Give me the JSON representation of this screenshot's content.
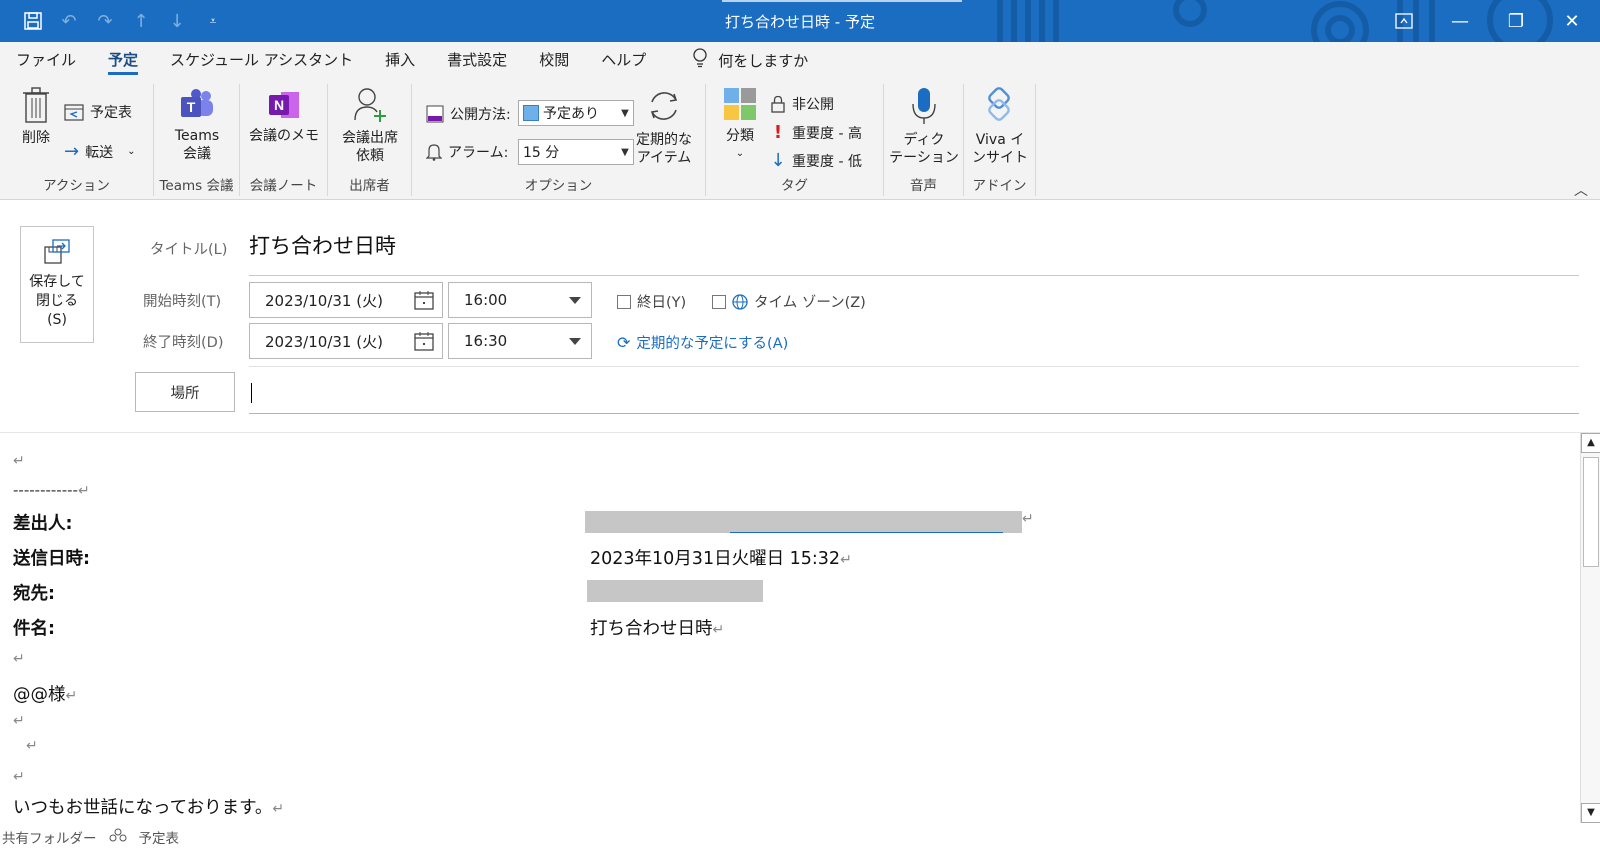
{
  "titlebar": {
    "title": "打ち合わせ日時 - 予定",
    "qat": [
      "save-icon",
      "undo-icon",
      "redo-icon",
      "up-icon",
      "down-icon",
      "customize-icon"
    ],
    "controls": [
      "ribbon-display-icon",
      "minimize-icon",
      "restore-icon",
      "close-icon"
    ]
  },
  "tabs": [
    "ファイル",
    "予定",
    "スケジュール アシスタント",
    "挿入",
    "書式設定",
    "校閲",
    "ヘルプ"
  ],
  "tellme": "何をしますか",
  "ribbon": {
    "actions": {
      "delete": "削除",
      "calendar": "予定表",
      "forward": "転送",
      "label": "アクション"
    },
    "teams": {
      "button": [
        "Teams",
        "会議"
      ],
      "label": "Teams 会議"
    },
    "notes": {
      "button": "会議のメモ",
      "label": "会議ノート"
    },
    "attendees": {
      "button": [
        "会議出席",
        "依頼"
      ],
      "label": "出席者"
    },
    "options": {
      "showas_label": "公開方法:",
      "showas_value": "予定あり",
      "reminder_label": "アラーム:",
      "reminder_value": "15 分",
      "recurrence": [
        "定期的な",
        "アイテム"
      ],
      "label": "オプション"
    },
    "tags": {
      "categorize": "分類",
      "private": "非公開",
      "high": "重要度 - 高",
      "low": "重要度 - 低",
      "label": "タグ"
    },
    "voice": {
      "button": [
        "ディク",
        "テーション"
      ],
      "label": "音声"
    },
    "addin": {
      "button": [
        "Viva イ",
        "ンサイト"
      ],
      "label": "アドイン"
    }
  },
  "form": {
    "save": [
      "保存して",
      "閉じる",
      "(S)"
    ],
    "title_label": "タイトル(L)",
    "title_value": "打ち合わせ日時",
    "start_label": "開始時刻(T)",
    "start_date": "2023/10/31 (火)",
    "start_time": "16:00",
    "end_label": "終了時刻(D)",
    "end_date": "2023/10/31 (火)",
    "end_time": "16:30",
    "allday": "終日(Y)",
    "timezone": "タイム ゾーン(Z)",
    "recurring": "定期的な予定にする(A)",
    "location_button": "場所"
  },
  "body": {
    "return_mark": "↵",
    "divider": "------------",
    "from_label": "差出人:",
    "sent_label": "送信日時:",
    "sent_value": "2023年10月31日火曜日 15:32",
    "to_label": "宛先:",
    "subject_label": "件名:",
    "subject_value": "打ち合わせ日時",
    "salutation": "@@様",
    "greeting": "いつもお世話になっております。"
  },
  "status": {
    "shared": "共有フォルダー",
    "calendar": "予定表"
  }
}
